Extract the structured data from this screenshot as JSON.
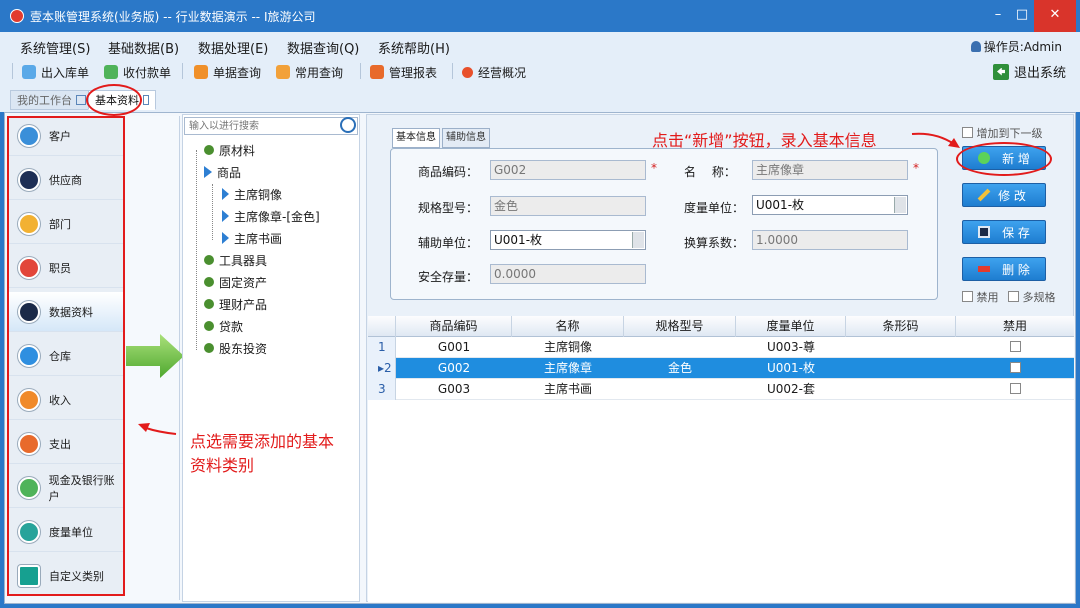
{
  "window": {
    "title": "壹本账管理系统(业务版) -- 行业数据演示 -- I旅游公司",
    "minimize": "–",
    "maximize": "□",
    "close": "✕"
  },
  "menu": [
    "系统管理(S)",
    "基础数据(B)",
    "数据处理(E)",
    "数据查询(Q)",
    "系统帮助(H)"
  ],
  "operator": "操作员:Admin",
  "toolbar": [
    "出入库单",
    "收付款单",
    "单据查询",
    "常用查询",
    "管理报表",
    "经营概况"
  ],
  "exit_label": "退出系统",
  "tabs": [
    "我的工作台",
    "基本资料"
  ],
  "sidebar": [
    "客户",
    "供应商",
    "部门",
    "职员",
    "数据资料",
    "仓库",
    "收入",
    "支出",
    "现金及银行账户",
    "度量单位",
    "自定义类别"
  ],
  "sidebar_active": "数据资料",
  "tree": {
    "search_placeholder": "输入以进行搜索",
    "nodes": [
      "原材料",
      "商品",
      "主席铜像",
      "主席像章-[金色]",
      "主席书画",
      "工具器具",
      "固定资产",
      "理财产品",
      "贷款",
      "股东投资"
    ]
  },
  "form": {
    "tabs": [
      "基本信息",
      "辅助信息"
    ],
    "labels": {
      "code": "商品编码：",
      "name": "名　 称：",
      "spec": "规格型号：",
      "unit": "度量单位：",
      "aux_unit": "辅助单位：",
      "ratio": "换算系数：",
      "safety": "安全存量："
    },
    "values": {
      "code": "G002",
      "name": "主席像章",
      "spec": "金色",
      "unit": "U001-枚",
      "aux_unit": "U001-枚",
      "ratio": "1.0000",
      "safety": "0.0000"
    },
    "required_mark": "*"
  },
  "options": {
    "add_to_next": "增加到下一级",
    "disabled": "禁用",
    "multi_spec": "多规格"
  },
  "buttons": {
    "add": "新 增",
    "edit": "修 改",
    "save": "保 存",
    "delete": "删 除"
  },
  "grid": {
    "columns": [
      "商品编码",
      "名称",
      "规格型号",
      "度量单位",
      "条形码",
      "禁用"
    ],
    "rows": [
      {
        "num": "1",
        "code": "G001",
        "name": "主席铜像",
        "spec": "",
        "unit": "U003-尊",
        "barcode": ""
      },
      {
        "num": "2",
        "code": "G002",
        "name": "主席像章",
        "spec": "金色",
        "unit": "U001-枚",
        "barcode": ""
      },
      {
        "num": "3",
        "code": "G003",
        "name": "主席书画",
        "spec": "",
        "unit": "U002-套",
        "barcode": ""
      }
    ],
    "selected_row": 2
  },
  "annotations": {
    "top": "点击“新增”按钮，录入基本信息",
    "left_line1": "点选需要添加的基本",
    "left_line2": "资料类别"
  },
  "colors": {
    "titlebar": "#2b78c8",
    "accent_blue": "#1f8ddf",
    "annotation_red": "#e21b1b",
    "close_red": "#d9342b"
  }
}
